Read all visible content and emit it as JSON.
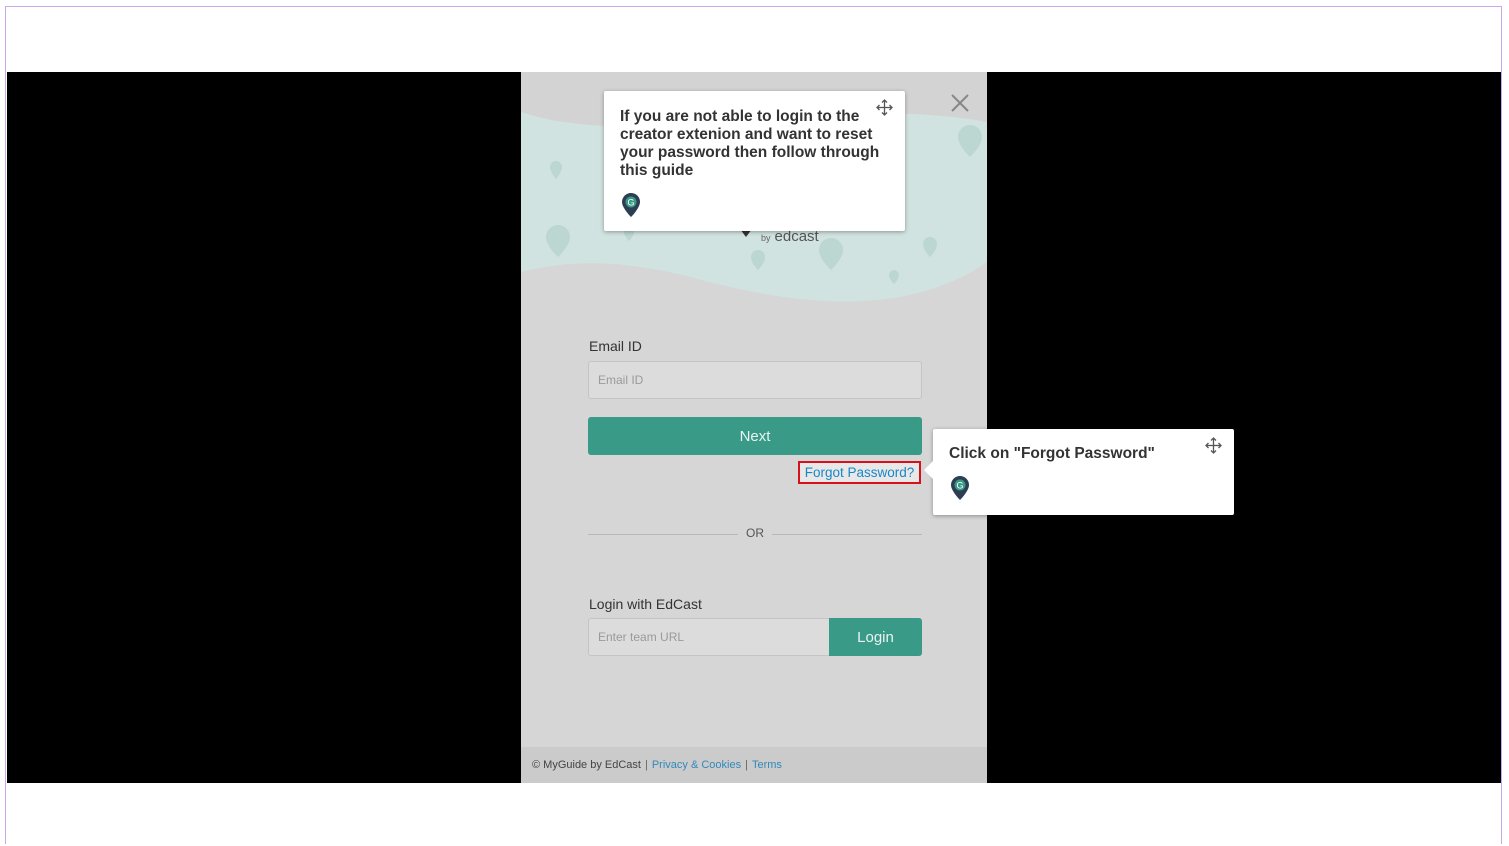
{
  "brand": {
    "by": "by",
    "name": "edcast"
  },
  "login_form": {
    "email_label": "Email ID",
    "email_placeholder": "Email ID",
    "email_value": "",
    "next_label": "Next",
    "forgot_label": "Forgot Password?",
    "or_label": "OR",
    "edcast_label": "Login with EdCast",
    "team_url_placeholder": "Enter team URL",
    "login_label": "Login"
  },
  "footer": {
    "copyright": "© MyGuide by EdCast",
    "privacy": "Privacy & Cookies",
    "terms": "Terms"
  },
  "tooltips": {
    "intro": {
      "text": "If you are not able to login to the creator extenion and want to reset your password then follow through this guide"
    },
    "step": {
      "text": "Click on \"Forgot Password\""
    }
  },
  "icons": {
    "close": "close-icon",
    "move": "move-icon",
    "guide": "myguide-pin-icon"
  },
  "colors": {
    "accent": "#3a9a88",
    "highlight": "#d8101a",
    "link": "#1a86c7"
  }
}
